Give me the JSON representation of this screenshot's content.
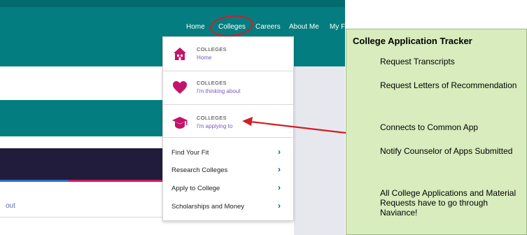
{
  "nav": {
    "items": [
      {
        "label": "Home"
      },
      {
        "label": "Colleges"
      },
      {
        "label": "Careers"
      },
      {
        "label": "About Me"
      },
      {
        "label": "My F"
      }
    ]
  },
  "dropdown": {
    "sections": [
      {
        "caption": "COLLEGES",
        "sub": "Home",
        "icon": "house-icon"
      },
      {
        "caption": "COLLEGES",
        "sub": "I'm thinking about",
        "icon": "heart-icon"
      },
      {
        "caption": "COLLEGES",
        "sub": "I'm applying to",
        "icon": "graduation-cap-icon"
      }
    ],
    "links": [
      {
        "label": "Find Your Fit"
      },
      {
        "label": "Research Colleges"
      },
      {
        "label": "Apply to College"
      },
      {
        "label": "Scholarships and Money"
      }
    ],
    "chevron": "›"
  },
  "left": {
    "link_text": "out"
  },
  "tracker": {
    "title": "College Application Tracker",
    "items": [
      "Request Transcripts",
      "Request Letters of Recommendation",
      "Connects to Common App",
      "Notify Counselor of Apps Submitted",
      "All College Applications and Material Requests have to go through Naviance!"
    ]
  },
  "colors": {
    "teal": "#047d80",
    "annotation_red": "#d41d24",
    "accent_magenta": "#c4136a",
    "tracker_green": "#d8ecbe"
  }
}
